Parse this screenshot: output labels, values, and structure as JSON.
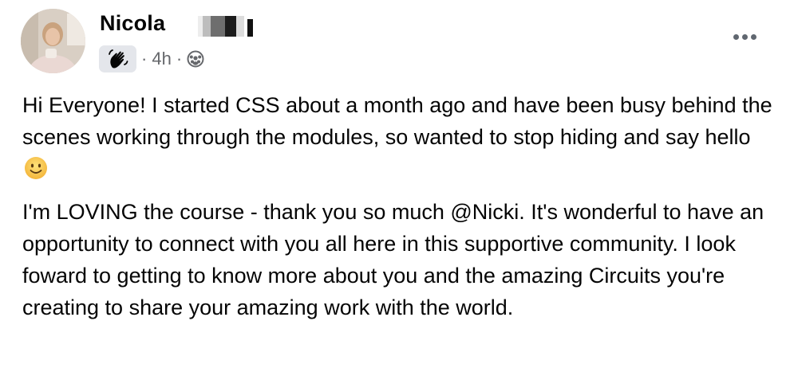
{
  "post": {
    "author": "Nicola",
    "time": "4h",
    "separator": "·",
    "badge_icon": "wave-hand-icon",
    "audience_icon": "group-icon",
    "more_icon": "more-options-icon",
    "paragraph1": "Hi Everyone! I started CSS about a month ago and have been busy behind the scenes working through the modules, so wanted to stop hiding and say hello",
    "paragraph1_emoji": "smiling-face-icon",
    "paragraph2": "I'm LOVING the course - thank you so much @Nicki. It's wonderful to have an opportunity to connect with you all here in this supportive community.  I look foward to getting to know more about you and the amazing Circuits you're creating to share your amazing work with the world."
  },
  "colors": {
    "text": "#050505",
    "secondary": "#65676b",
    "badge_bg": "#e4e6eb",
    "emoji": "#f7c33b"
  }
}
